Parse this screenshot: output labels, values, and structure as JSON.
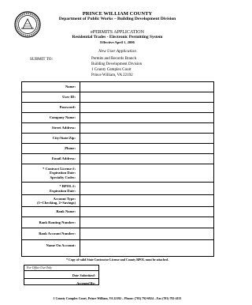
{
  "header": {
    "county": "PRINCE WILLIAM COUNTY",
    "department": "Department of Public Works – Building Development Division",
    "program": "ePERMITS APPLICATION",
    "system": "Residential Trades - Electronic Permitting System",
    "effective": "Effective April 1, 2006",
    "form_title": "New User Application"
  },
  "submit": {
    "label": "SUBMIT TO:",
    "address": [
      "Permits and Records Branch",
      "Building Development Division",
      "1 County Complex Court",
      "Prince William, VA  22192"
    ]
  },
  "form": {
    "fields": [
      {
        "lines": [
          "Name:"
        ]
      },
      {
        "lines": [
          "User ID:"
        ]
      },
      {
        "lines": [
          "Password:"
        ]
      },
      {
        "lines": [
          "Company Name:"
        ]
      },
      {
        "lines": [
          "Street Address:"
        ]
      },
      {
        "lines": [
          "City/State/Zip:"
        ]
      },
      {
        "lines": [
          "Phone:"
        ]
      },
      {
        "lines": [
          "Email Address:"
        ]
      },
      {
        "lines": [
          "* Contract License #:",
          "Expiration Date:",
          "Specialty Codes:"
        ]
      },
      {
        "lines": [
          "* BPOL #:",
          "Expiration Date:"
        ]
      },
      {
        "lines": [
          "Account Type:",
          "(1=Checking, 2=Savings)"
        ]
      },
      {
        "lines": [
          "Bank Name:"
        ]
      },
      {
        "lines": [
          "Bank Routing Number:"
        ]
      },
      {
        "lines": [
          "Bank Account Number:"
        ]
      },
      {
        "lines": [
          "Name On Account:"
        ]
      }
    ]
  },
  "footnote": "* Copy of valid State Contractor License and County BPOL must be attached.",
  "office_use": {
    "heading": "For Office Use Only",
    "date_label": "Date Submitted:",
    "accepted_label": "Accepted By:"
  },
  "footer": "1 County Complex Court, Prince William, VA 22192 – Phone: (703) 792-6924 – Fax (703) 792-4155",
  "seal": {
    "icon": "county-seal-icon",
    "color": "#000000"
  }
}
